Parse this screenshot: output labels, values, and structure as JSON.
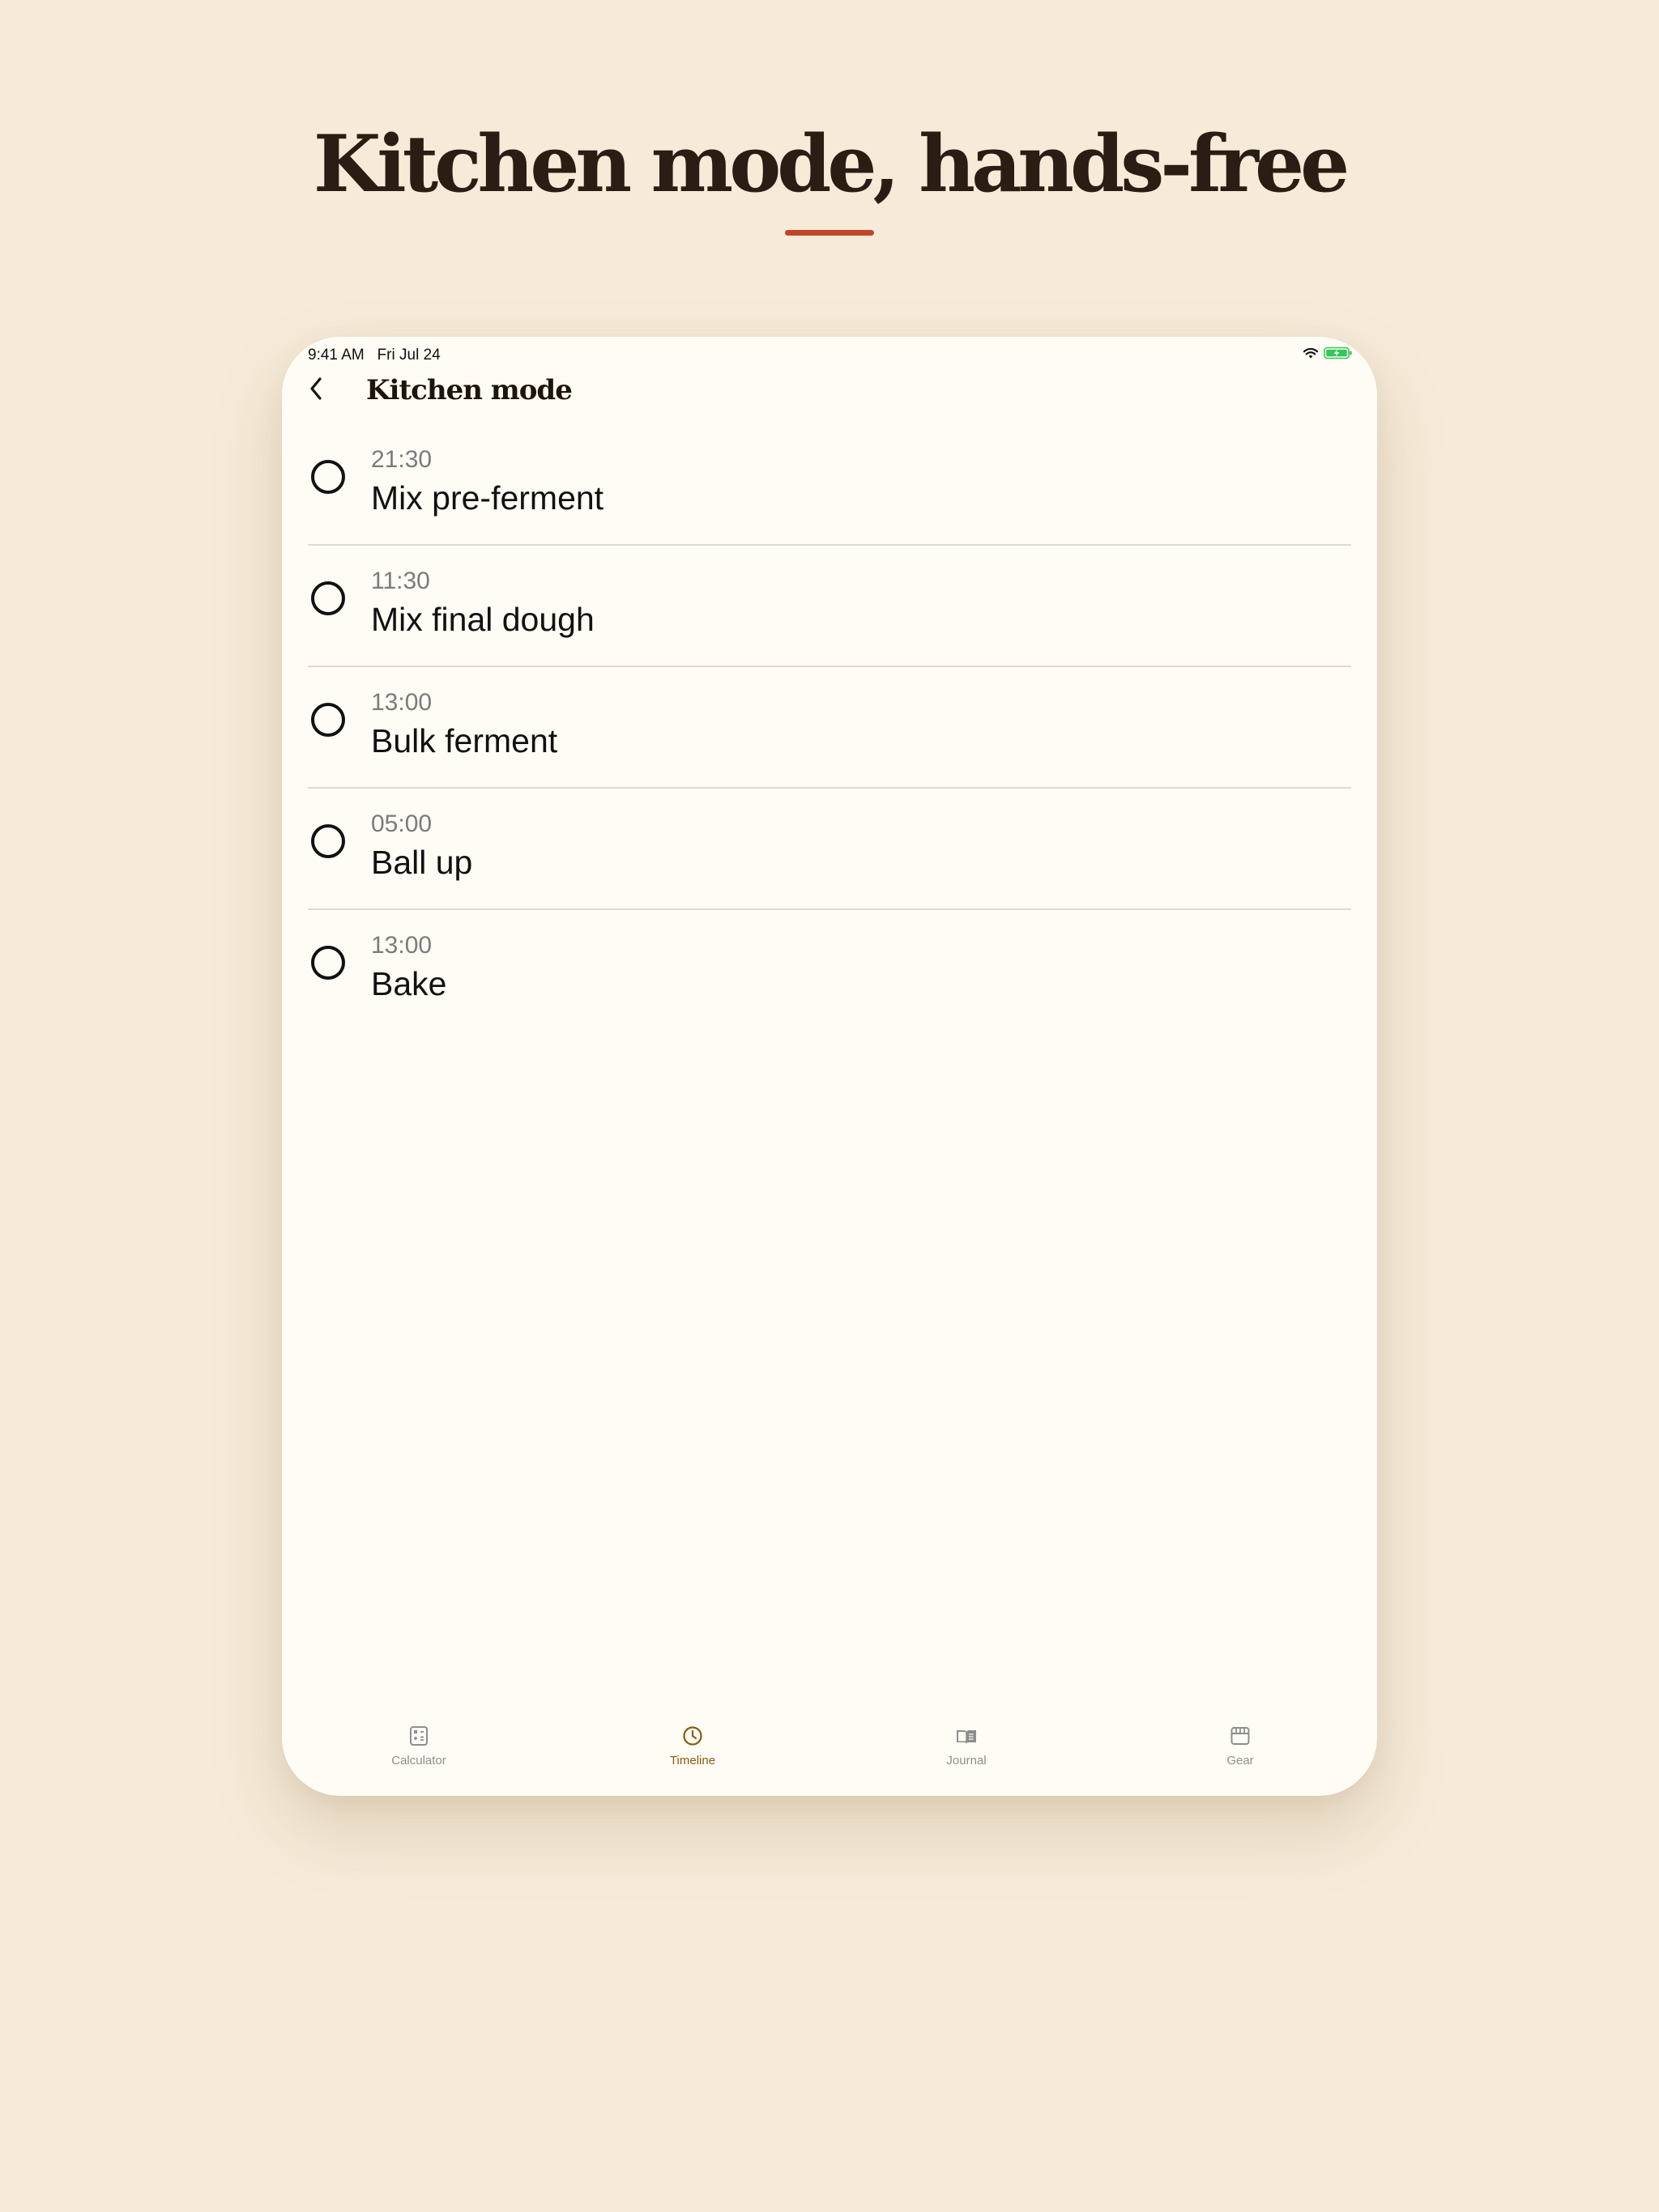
{
  "headline": "Kitchen mode, hands-free",
  "colors": {
    "background": "#f6ebd9",
    "accent_rule": "#c0452a",
    "screen": "#fefcf5",
    "active_tab": "#8a5a10",
    "battery": "#34c759"
  },
  "status_bar": {
    "time": "9:41 AM",
    "date": "Fri Jul 24",
    "icons": [
      "wifi-icon",
      "battery-charging-icon"
    ]
  },
  "nav": {
    "back_icon": "chevron-left-icon",
    "title": "Kitchen mode"
  },
  "steps": [
    {
      "time": "21:30",
      "title": "Mix pre-ferment",
      "done": false
    },
    {
      "time": "11:30",
      "title": "Mix final dough",
      "done": false
    },
    {
      "time": "13:00",
      "title": "Bulk ferment",
      "done": false
    },
    {
      "time": "05:00",
      "title": "Ball up",
      "done": false
    },
    {
      "time": "13:00",
      "title": "Bake",
      "done": false
    }
  ],
  "tabs": [
    {
      "label": "Calculator",
      "icon": "calculator-icon",
      "active": false
    },
    {
      "label": "Timeline",
      "icon": "clock-icon",
      "active": true
    },
    {
      "label": "Journal",
      "icon": "book-icon",
      "active": false
    },
    {
      "label": "Gear",
      "icon": "storefront-icon",
      "active": false
    }
  ]
}
